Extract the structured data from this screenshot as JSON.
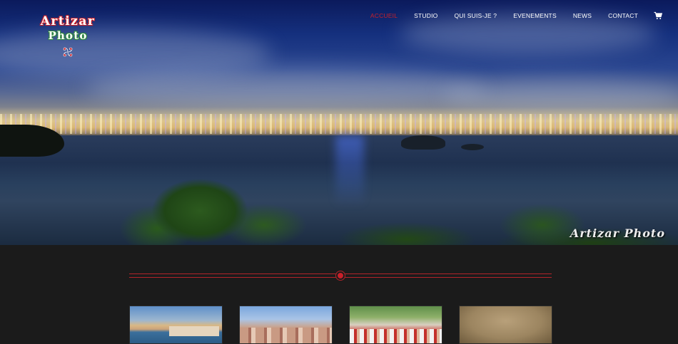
{
  "logo": {
    "line1": "Artizar",
    "line2": "Photo",
    "emblem": "lauburu-icon",
    "colors": {
      "primary_stroke": "#c8202a",
      "secondary_stroke": "#2e8b3a"
    }
  },
  "nav": {
    "items": [
      {
        "label": "ACCUEIL",
        "active": true
      },
      {
        "label": "STUDIO",
        "active": false
      },
      {
        "label": "QUI SUIS-JE ?",
        "active": false
      },
      {
        "label": "EVENEMENTS",
        "active": false
      },
      {
        "label": "NEWS",
        "active": false
      },
      {
        "label": "CONTACT",
        "active": false
      }
    ],
    "cart_icon": "cart-icon",
    "active_color": "#c8202a"
  },
  "hero": {
    "watermark": "Artizar Photo"
  },
  "divider": {
    "color": "#b3242a"
  },
  "gallery": {
    "thumbnails": [
      {
        "subject": "coast-town"
      },
      {
        "subject": "street-houses"
      },
      {
        "subject": "crowd-event"
      },
      {
        "subject": "sand-texture"
      }
    ]
  },
  "theme": {
    "background": "#1b1b1b",
    "accent": "#c8202a"
  }
}
